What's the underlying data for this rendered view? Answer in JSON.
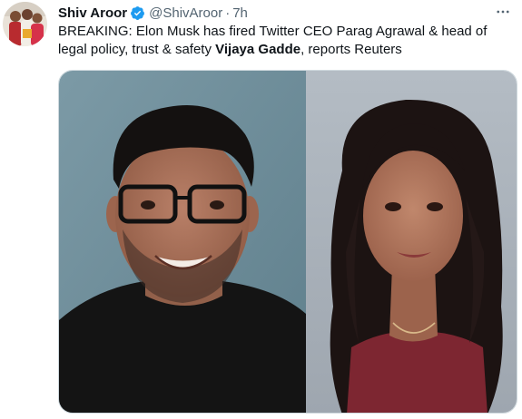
{
  "author": {
    "display_name": "Shiv Aroor",
    "handle": "@ShivAroor",
    "separator": "·",
    "time_ago": "7h",
    "verified": true
  },
  "tweet": {
    "text_part1": "BREAKING: Elon Musk has fired Twitter CEO Parag Agrawal & head of legal policy, trust & safety ",
    "text_bold": "Vijaya Gadde",
    "text_part2": ", reports Reuters"
  },
  "media": {
    "count": 2
  },
  "icons": {
    "verified": "verified-badge-icon",
    "more": "more-options-icon"
  },
  "colors": {
    "verified_blue": "#1d9bf0",
    "secondary_text": "#536471",
    "primary_text": "#0f1419",
    "photo_left_bg": "#6e8e9a",
    "photo_right_bg": "#a9b1ba"
  }
}
